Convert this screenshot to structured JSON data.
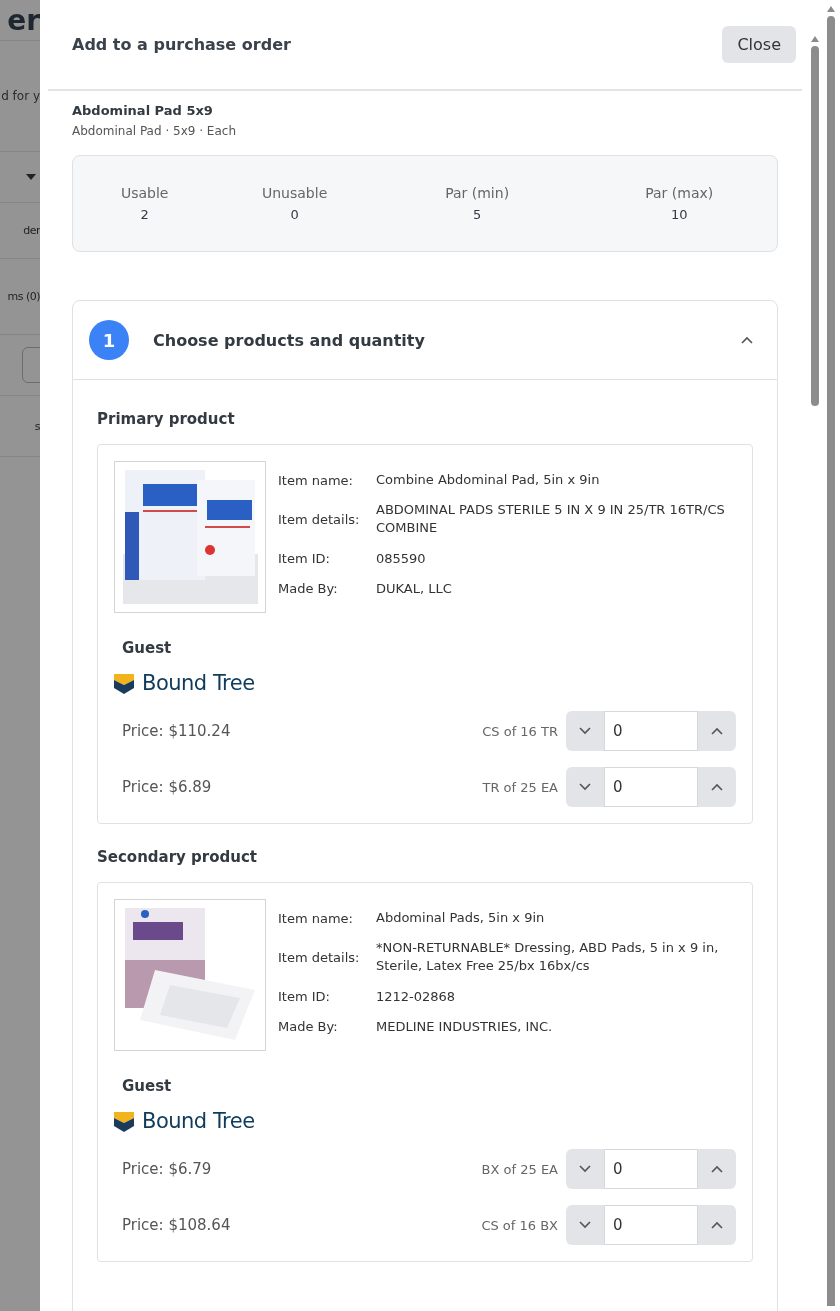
{
  "background": {
    "fragments": [
      {
        "kind": "heading",
        "text": "er"
      },
      {
        "kind": "note",
        "text": "d for y"
      },
      {
        "kind": "dropdown"
      },
      {
        "kind": "text",
        "text": "der"
      },
      {
        "kind": "text",
        "text": "ms (0)"
      },
      {
        "kind": "button"
      },
      {
        "kind": "text",
        "text": "s"
      }
    ]
  },
  "dialog": {
    "title": "Add to a purchase order",
    "close_button": "Close"
  },
  "item": {
    "name": "Abdominal Pad 5x9",
    "subtitle": "Abdominal Pad · 5x9 · Each"
  },
  "stock": [
    {
      "label": "Usable",
      "value": "2"
    },
    {
      "label": "Unusable",
      "value": "0"
    },
    {
      "label": "Par (min)",
      "value": "5"
    },
    {
      "label": "Par (max)",
      "value": "10"
    }
  ],
  "step": {
    "number": "1",
    "title": "Choose products and quantity",
    "expanded": true
  },
  "products": [
    {
      "heading": "Primary product",
      "fields": [
        {
          "label": "Item name:",
          "value": "Combine Abdominal Pad, 5in x 9in"
        },
        {
          "label": "Item details:",
          "value": "ABDOMINAL PADS STERILE 5 IN X 9 IN 25/TR 16TR/CS COMBINE"
        },
        {
          "label": "Item ID:",
          "value": "085590"
        },
        {
          "label": "Made By:",
          "value": "DUKAL, LLC"
        }
      ],
      "account": "Guest",
      "vendor": "Bound Tree",
      "prices": [
        {
          "price": "Price: $110.24",
          "unit": "CS of 16 TR",
          "quantity": "0"
        },
        {
          "price": "Price: $6.89",
          "unit": "TR of 25 EA",
          "quantity": "0"
        }
      ]
    },
    {
      "heading": "Secondary product",
      "fields": [
        {
          "label": "Item name:",
          "value": "Abdominal Pads, 5in x 9in"
        },
        {
          "label": "Item details:",
          "value": "*NON-RETURNABLE* Dressing, ABD Pads, 5 in x 9 in, Sterile, Latex Free 25/bx 16bx/cs"
        },
        {
          "label": "Item ID:",
          "value": "1212-02868"
        },
        {
          "label": "Made By:",
          "value": "MEDLINE INDUSTRIES, INC."
        }
      ],
      "account": "Guest",
      "vendor": "Bound Tree",
      "prices": [
        {
          "price": "Price: $6.79",
          "unit": "BX of 25 EA",
          "quantity": "0"
        },
        {
          "price": "Price: $108.64",
          "unit": "CS of 16 BX",
          "quantity": "0"
        }
      ]
    }
  ]
}
